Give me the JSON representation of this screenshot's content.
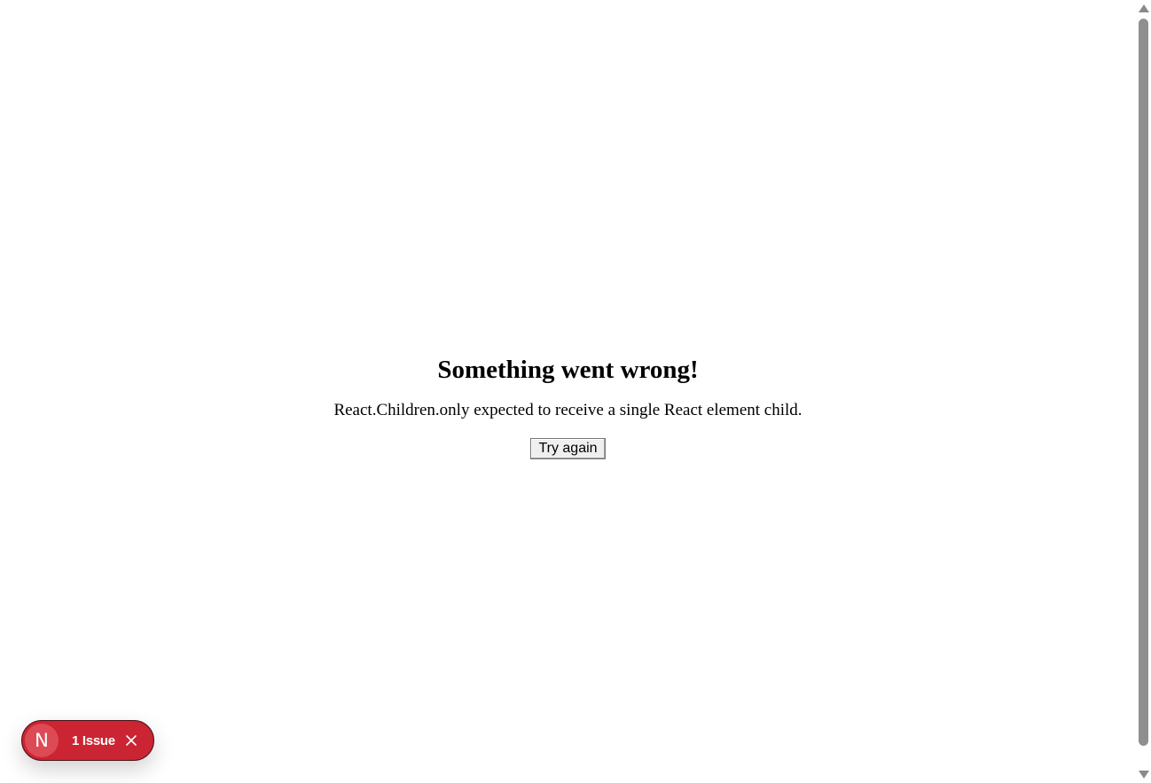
{
  "error": {
    "title": "Something went wrong!",
    "message": "React.Children.only expected to receive a single React element child.",
    "retry_label": "Try again"
  },
  "issue_badge": {
    "logo_letter": "N",
    "label": "1 Issue",
    "icons": {
      "logo": "nextjs-logo-icon",
      "close": "close-icon"
    },
    "colors": {
      "background": "#cb2432",
      "logo_circle": "#dc4a55",
      "text": "#ffffff"
    }
  },
  "scrollbar": {
    "icons": [
      "scroll-up-arrow-icon",
      "scroll-down-arrow-icon"
    ]
  }
}
